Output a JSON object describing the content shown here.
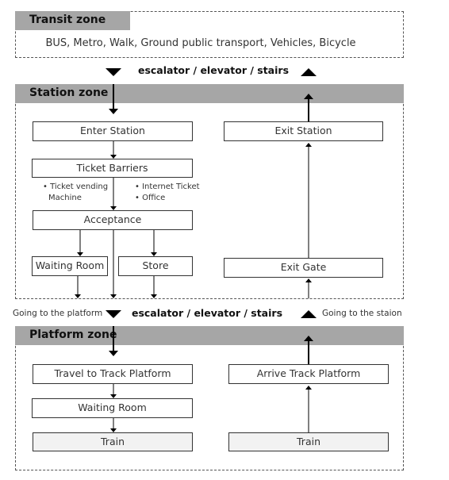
{
  "transit_zone": {
    "title": "Transit zone",
    "modes": "BUS,  Metro, Walk, Ground public transport, Vehicles, Bicycle"
  },
  "connector_top": {
    "label": "escalator / elevator / stairs"
  },
  "station_zone": {
    "title": "Station zone",
    "enter_station": "Enter Station",
    "ticket_barriers": "Ticket Barriers",
    "left_notes": [
      "• Ticket vending",
      "Machine"
    ],
    "right_notes": [
      "• Internet Ticket",
      "• Office"
    ],
    "acceptance": "Acceptance",
    "waiting_room": "Waiting Room",
    "store": "Store",
    "exit_station": "Exit Station",
    "exit_gate": "Exit Gate"
  },
  "connector_middle": {
    "left_label": "Going to the platform",
    "label": "escalator / elevator / stairs",
    "right_label": "Going to the staion"
  },
  "platform_zone": {
    "title": "Platform zone",
    "travel_to_track": "Travel to Track Platform",
    "waiting_room": "Waiting Room",
    "train_left": "Train",
    "arrive_track": "Arrive Track Platform",
    "train_right": "Train"
  }
}
